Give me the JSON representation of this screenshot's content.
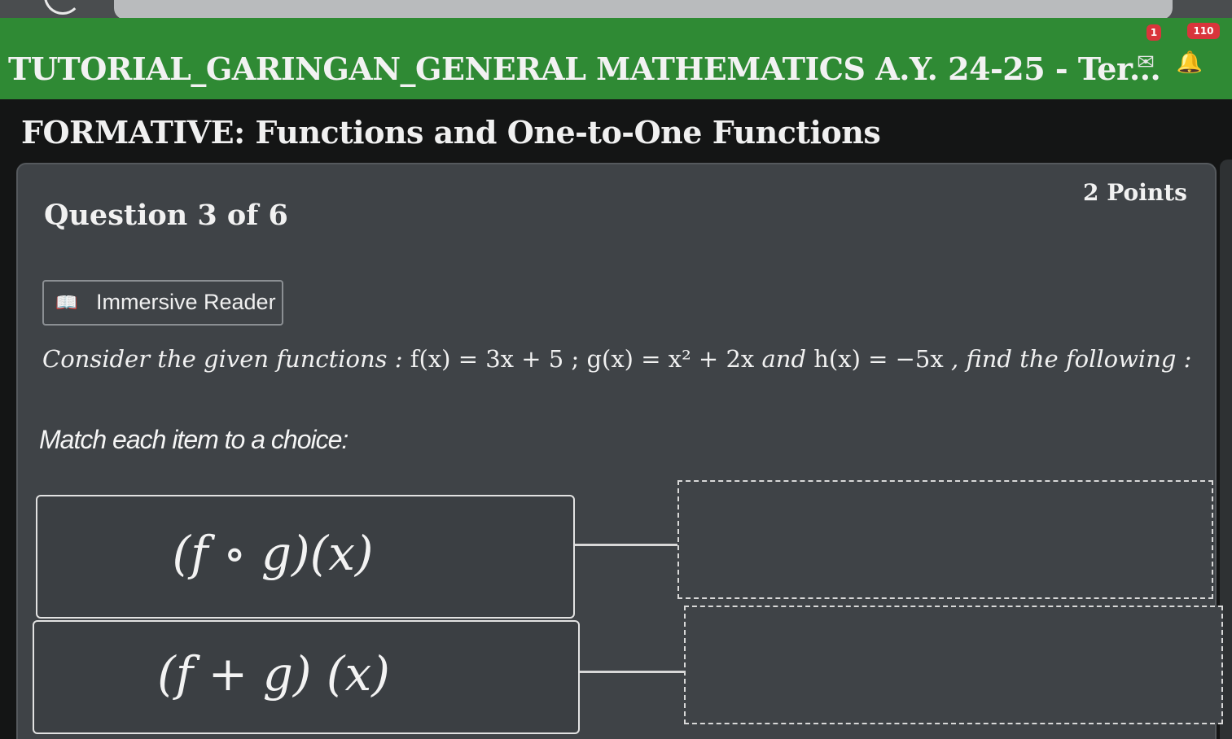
{
  "header": {
    "title": "TUTORIAL_GARINGAN_GENERAL MATHEMATICS A.Y. 24-25 - Ter...",
    "messages_badge": "1",
    "notifications_badge": "110"
  },
  "page_title": "FORMATIVE: Functions and One-to-One Functions",
  "question": {
    "number_label": "Question 3 of 6",
    "points_label": "2 Points",
    "immersive_reader_label": "Immersive Reader",
    "prompt_lead": "Consider the given functions :",
    "f_def": "f(x) = 3x + 5",
    "sep": ";",
    "g_def": "g(x) = x² + 2x",
    "and_word": "and",
    "h_def": "h(x) = −5x",
    "prompt_tail": ", find the following :",
    "instruction": "Match each item to a choice:"
  },
  "match_items": [
    {
      "label": "(f ∘ g)(x)"
    },
    {
      "label": "(f + g) (x)"
    }
  ],
  "colors": {
    "header_green": "#2f8a34",
    "card_bg": "#3f4347",
    "badge_red": "#d9353b"
  }
}
